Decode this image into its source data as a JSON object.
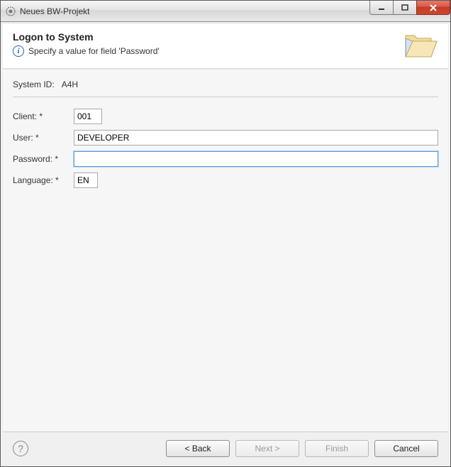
{
  "window": {
    "title": "Neues BW-Projekt"
  },
  "header": {
    "title": "Logon to System",
    "message": "Specify a value for field 'Password'"
  },
  "system": {
    "label": "System ID:",
    "value": "A4H"
  },
  "form": {
    "client": {
      "label": "Client: *",
      "value": "001"
    },
    "user": {
      "label": "User: *",
      "value": "DEVELOPER"
    },
    "password": {
      "label": "Password: *",
      "value": ""
    },
    "language": {
      "label": "Language: *",
      "value": "EN"
    }
  },
  "buttons": {
    "back": "< Back",
    "next": "Next >",
    "finish": "Finish",
    "cancel": "Cancel"
  }
}
